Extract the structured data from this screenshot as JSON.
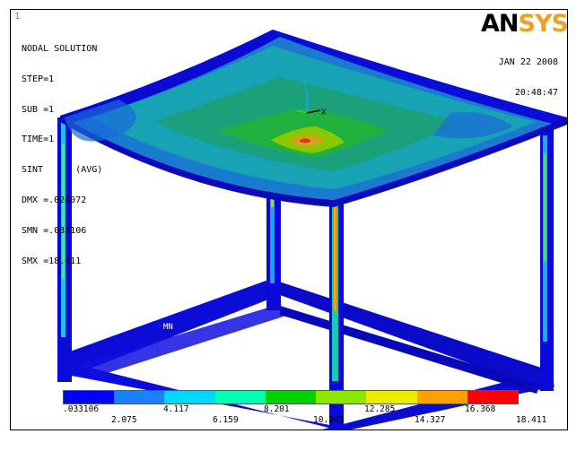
{
  "window_number": "1",
  "solution": {
    "title": "NODAL SOLUTION",
    "lines": [
      "STEP=1",
      "SUB =1",
      "TIME=1",
      "SINT      (AVG)",
      "DMX =.024072",
      "SMN =.033106",
      "SMX =18.411"
    ]
  },
  "branding": {
    "logo_left": "AN",
    "logo_right": "SYS"
  },
  "timestamp": {
    "date": "JAN 22 2008",
    "time": "20:48:47"
  },
  "triad": {
    "x": "X",
    "y": "Y",
    "z": "Z"
  },
  "marker": "MN",
  "legend": {
    "colors": [
      "#0000ff",
      "#1a82ff",
      "#00d8ff",
      "#00ffb0",
      "#00d000",
      "#88e800",
      "#ecec00",
      "#ffa000",
      "#ff0000"
    ],
    "labels_bottom": [
      ".033106",
      "4.117",
      "8.201",
      "12.285",
      "16.368"
    ],
    "labels_top": [
      "2.075",
      "6.159",
      "10.243",
      "14.327",
      "18.411"
    ]
  },
  "colors": {
    "frame_blue": "#0000d8",
    "slab_green": "#1a9f7a",
    "slab_cyan": "#16a3b0",
    "hotspot": "#d8a020"
  }
}
